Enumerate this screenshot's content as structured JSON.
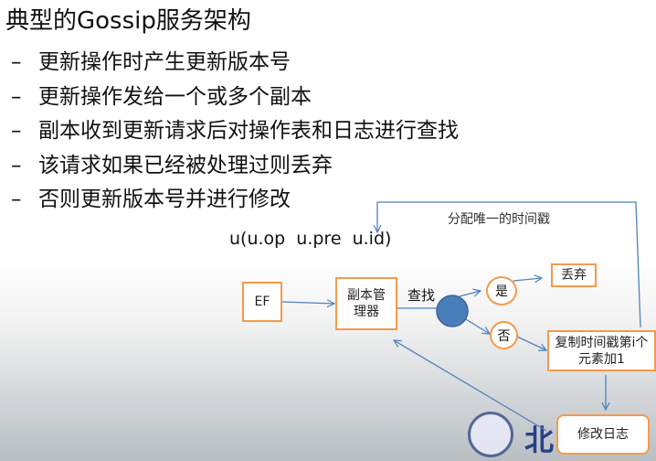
{
  "title": "典型的Gossip服务架构",
  "bullets": [
    "更新操作时产生更新版本号",
    "更新操作发给一个或多个副本",
    "副本收到更新请求后对操作表和日志进行查找",
    "该请求如果已经被处理过则丢弃",
    "否则更新版本号并进行修改"
  ],
  "bullet_dash": "–",
  "diagram": {
    "update_tuple": "u(u.op  u.pre  u.id)",
    "assign_label": "分配唯一的时间戳",
    "ef": "EF",
    "replica_manager": "副本管理器",
    "lookup": "查找",
    "yes": "是",
    "no": "否",
    "discard": "丢弃",
    "copy_timestamp": "复制时间戳第i个元素加1",
    "modify_log": "修改日志"
  },
  "logo_text": "北",
  "colors": {
    "box_border": "#f39a4b",
    "arrow": "#4f81bd",
    "node": "#4a7ebb"
  }
}
